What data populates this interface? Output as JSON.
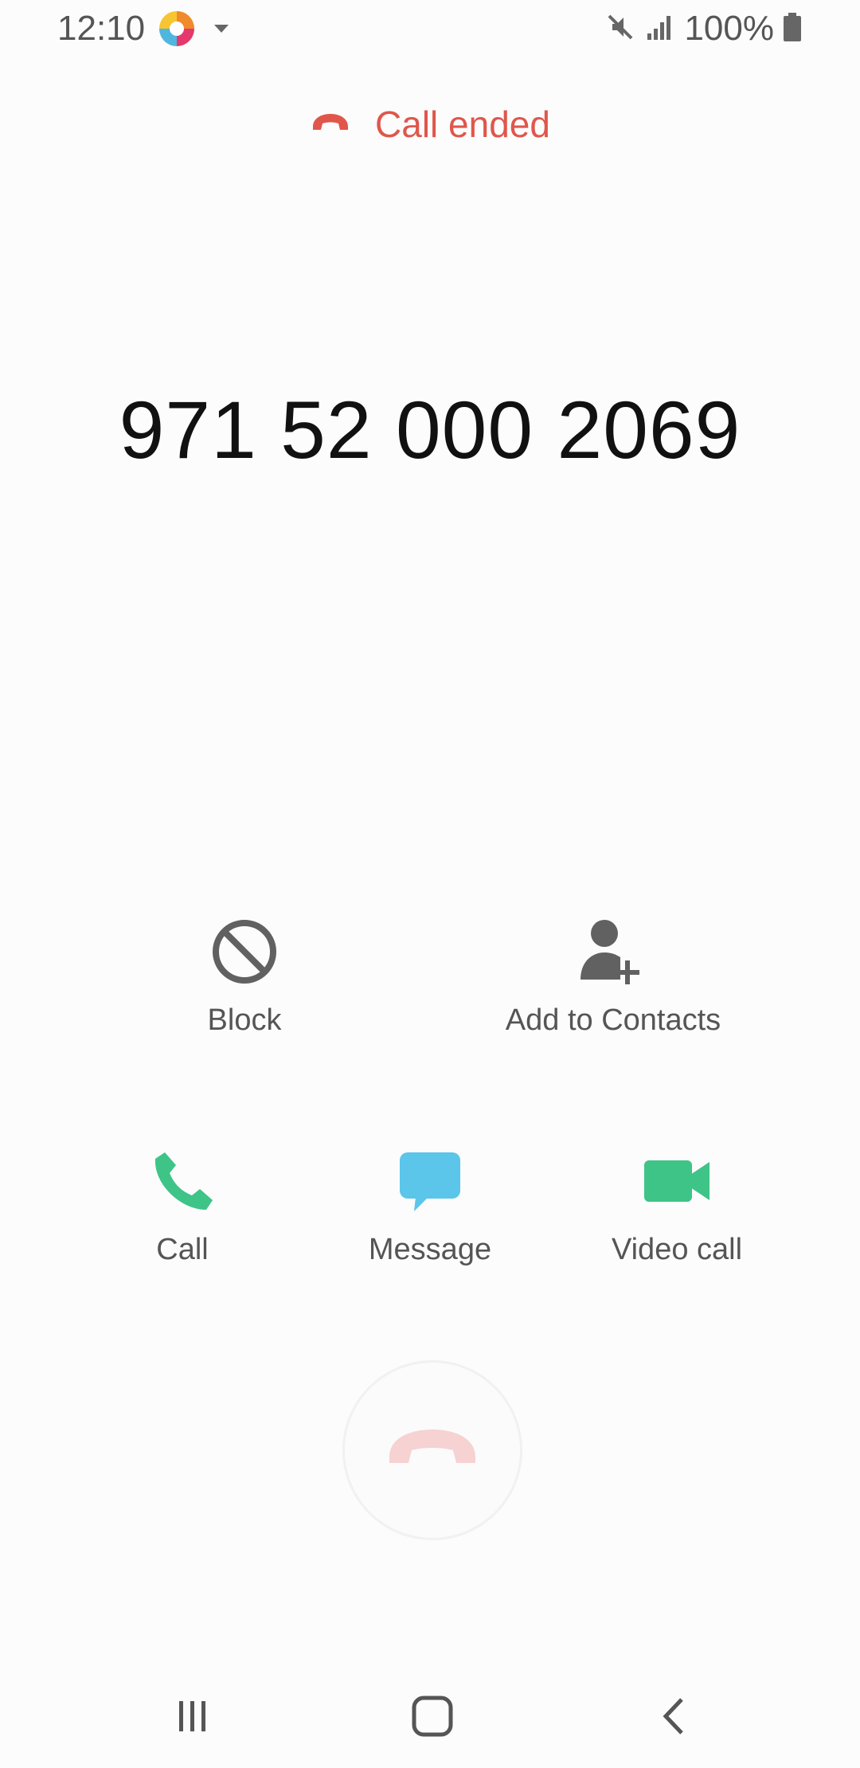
{
  "status_bar": {
    "time": "12:10",
    "battery_percent": "100%",
    "icons": [
      "app-icon",
      "dropdown-arrow-icon",
      "mute-icon",
      "signal-icon",
      "battery-icon"
    ]
  },
  "call": {
    "status_text": "Call ended",
    "number": "971 52 000 2069"
  },
  "actions": {
    "block": {
      "label": "Block",
      "icon": "block-icon"
    },
    "add_contact": {
      "label": "Add to Contacts",
      "icon": "add-person-icon"
    },
    "call": {
      "label": "Call",
      "icon": "phone-icon"
    },
    "message": {
      "label": "Message",
      "icon": "message-bubble-icon"
    },
    "video_call": {
      "label": "Video call",
      "icon": "video-camera-icon"
    }
  },
  "end_call": {
    "icon": "end-call-icon"
  },
  "nav": {
    "icons": [
      "recents-icon",
      "home-icon",
      "back-icon"
    ]
  },
  "colors": {
    "call_ended_red": "#e0564b",
    "call_green": "#3ec487",
    "message_blue": "#5bc5ea",
    "icon_gray": "#616161"
  }
}
